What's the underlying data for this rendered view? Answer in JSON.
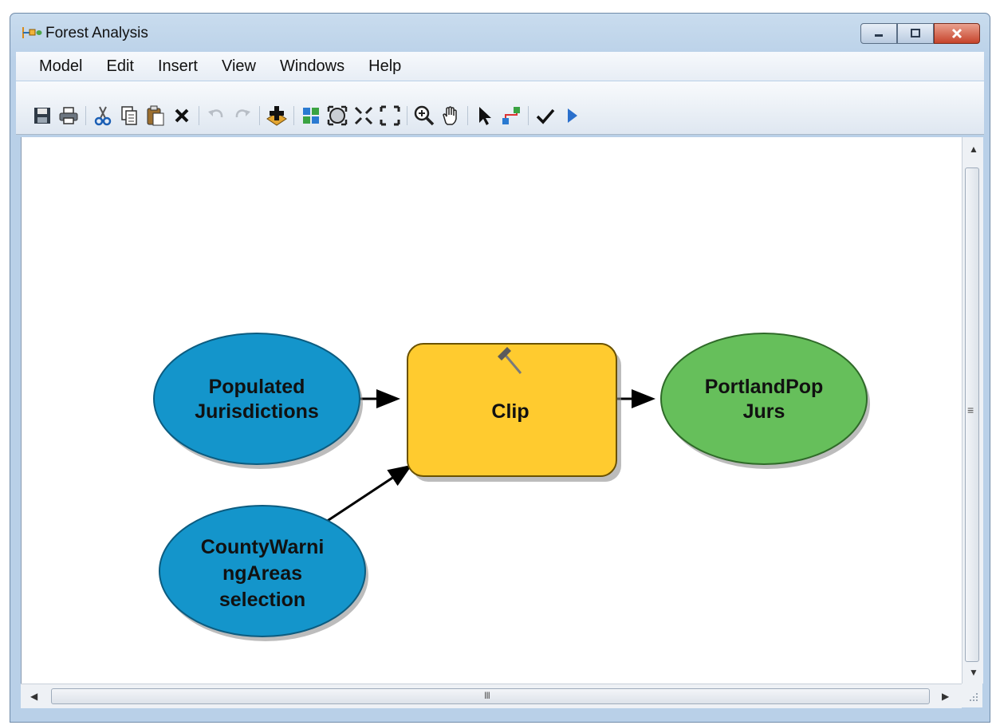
{
  "window": {
    "title": "Forest Analysis"
  },
  "menu": [
    "Model",
    "Edit",
    "Insert",
    "View",
    "Windows",
    "Help"
  ],
  "toolbar": {
    "icons": [
      "save-icon",
      "print-icon",
      "cut-icon",
      "copy-icon",
      "paste-icon",
      "delete-icon",
      "undo-icon",
      "redo-icon",
      "add-data-icon",
      "auto-layout-icon",
      "full-extent-icon",
      "zoom-in-fixed-icon",
      "zoom-out-fixed-icon",
      "zoom-in-icon",
      "pan-icon",
      "select-icon",
      "connect-icon",
      "validate-icon",
      "run-icon"
    ]
  },
  "diagram": {
    "nodes": {
      "populated": {
        "lines": [
          "Populated",
          "Jurisdictions"
        ],
        "color": "#1495cb"
      },
      "county": {
        "lines": [
          "CountyWarni",
          "ngAreas",
          "selection"
        ],
        "color": "#1495cb"
      },
      "clip": {
        "lines": [
          "Clip"
        ],
        "color": "#ffcb2f"
      },
      "output": {
        "lines": [
          "PortlandPop",
          "Jurs"
        ],
        "color": "#66bf5b"
      }
    }
  },
  "scrollbar": {
    "h_grip": "III",
    "v_grip": "≡"
  }
}
